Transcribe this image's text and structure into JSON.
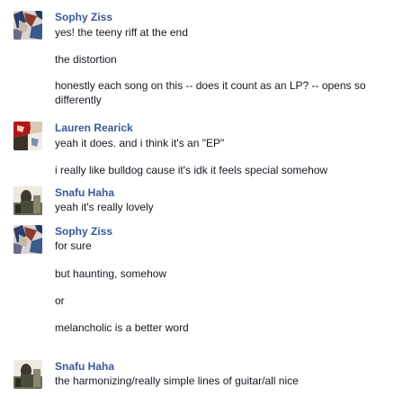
{
  "messages": [
    {
      "sender": "Sophy Ziss",
      "avatar": "abstract-art-avatar",
      "lines": [
        "yes! the teeny riff at the end",
        "the distortion",
        "honestly each song on this -- does it count as an LP? -- opens so differently"
      ]
    },
    {
      "sender": "Lauren Rearick",
      "avatar": "comic-art-avatar",
      "lines": [
        "yeah it does. and i think it's an \"EP\"",
        "i really like bulldog cause it's idk it feels special somehow"
      ]
    },
    {
      "sender": "Snafu Haha",
      "avatar": "band-photo-avatar",
      "lines": [
        "yeah it's really lovely"
      ]
    },
    {
      "sender": "Sophy Ziss",
      "avatar": "abstract-art-avatar",
      "lines": [
        "for sure",
        "but haunting, somehow",
        "or",
        "melancholic is a better word"
      ]
    },
    {
      "sender": "Snafu Haha",
      "avatar": "band-photo-avatar",
      "lines": [
        "the harmonizing/really simple lines of guitar/all nice"
      ]
    }
  ],
  "colors": {
    "name": "#3b5998",
    "text": "#141823"
  }
}
